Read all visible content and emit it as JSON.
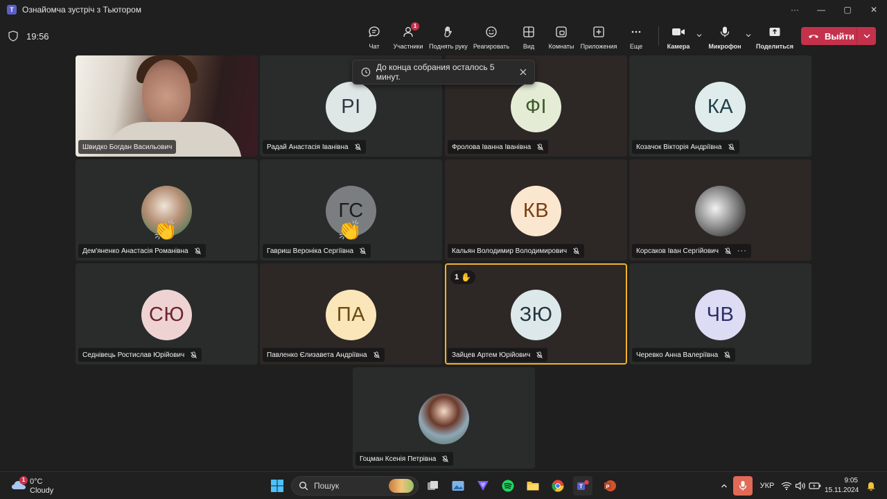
{
  "window": {
    "title": "Ознайомча зустріч з Тьютором",
    "controls": [
      "···",
      "—",
      "▢",
      "✕"
    ]
  },
  "toolbar": {
    "timer": "19:56",
    "buttons": [
      {
        "id": "chat",
        "label": "Чат",
        "icon": "chat-icon"
      },
      {
        "id": "participants",
        "label": "Участники",
        "icon": "people-icon",
        "badge": "1"
      },
      {
        "id": "raise-hand",
        "label": "Поднять руку",
        "icon": "hand-icon"
      },
      {
        "id": "react",
        "label": "Реагировать",
        "icon": "smile-icon"
      },
      {
        "id": "view",
        "label": "Вид",
        "icon": "grid-icon"
      },
      {
        "id": "rooms",
        "label": "Комнаты",
        "icon": "rooms-icon"
      },
      {
        "id": "apps",
        "label": "Приложения",
        "icon": "plus-icon"
      },
      {
        "id": "more",
        "label": "Еще",
        "icon": "more-icon"
      }
    ],
    "camera_label": "Камера",
    "mic_label": "Микрофон",
    "share_label": "Поделиться",
    "leave_label": "Выйти",
    "leave_color": "#c4314b"
  },
  "toast": {
    "text": "До конца собрания осталось 5 минут."
  },
  "participants": [
    {
      "name": "Швидко Богдан Васильович",
      "type": "video"
    },
    {
      "name": "Радай Анастасія Іванівна",
      "initials": "РІ",
      "avatar_bg": "#dfe6e6",
      "avatar_fg": "#2b3a45",
      "muted": true
    },
    {
      "name": "Фролова Іванна Іванівна",
      "initials": "ФІ",
      "avatar_bg": "#e4ecd6",
      "avatar_fg": "#3e5a2a",
      "muted": true
    },
    {
      "name": "Козачок Вікторія Андріївна",
      "initials": "КА",
      "avatar_bg": "#e0ecec",
      "avatar_fg": "#1f3e48",
      "muted": true
    },
    {
      "name": "Дем'яненко Анастасія Романівна",
      "type": "photo",
      "muted": true,
      "reaction": "👏"
    },
    {
      "name": "Гавриш Вероніка Сергіївна",
      "initials": "ГС",
      "avatar_bg": "#7a7e80",
      "avatar_fg": "#1c1c1c",
      "muted": true,
      "reaction": "👏"
    },
    {
      "name": "Кальян Володимир Володимирович",
      "initials": "КВ",
      "avatar_bg": "#fbe6cf",
      "avatar_fg": "#7a3e10",
      "muted": true
    },
    {
      "name": "Корсаков Іван Сергійович",
      "type": "photo-bw",
      "muted": true,
      "more": "···"
    },
    {
      "name": "Седнівець Ростислав Юрійович",
      "initials": "СЮ",
      "avatar_bg": "#efd3d3",
      "avatar_fg": "#6b2430",
      "muted": true
    },
    {
      "name": "Павленко Єлизавета Андріївна",
      "initials": "ПА",
      "avatar_bg": "#fae6b8",
      "avatar_fg": "#6b4a12",
      "muted": true
    },
    {
      "name": "Зайцев Артем Юрійович",
      "initials": "ЗЮ",
      "avatar_bg": "#dde8ea",
      "avatar_fg": "#243640",
      "muted": true,
      "hand_raised": "1",
      "active": true
    },
    {
      "name": "Черевко Анна Валеріївна",
      "initials": "ЧВ",
      "avatar_bg": "#dcdcf4",
      "avatar_fg": "#2d2d66",
      "muted": true
    },
    {
      "name": "Гоцман Ксенія Петрівна",
      "type": "photo-color",
      "muted": true
    }
  ],
  "taskbar": {
    "weather_badge": "1",
    "weather_temp": "0°C",
    "weather_cond": "Cloudy",
    "search_placeholder": "Пошук",
    "language": "УКР",
    "time": "9:05",
    "date": "15.11.2024"
  }
}
